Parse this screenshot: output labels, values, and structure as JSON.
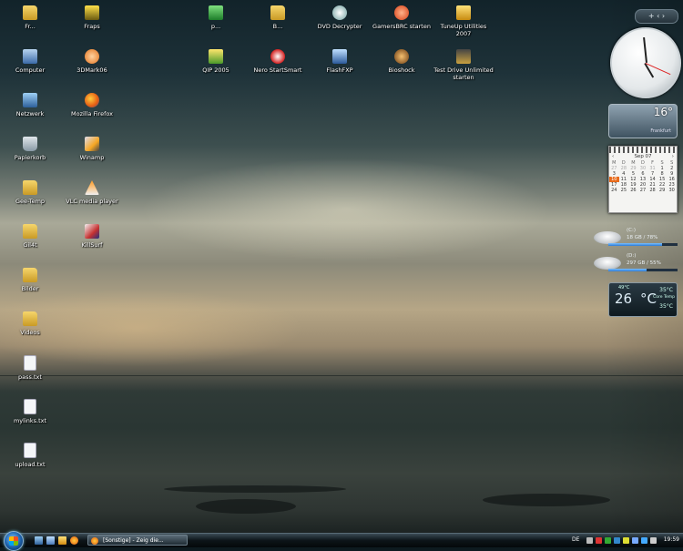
{
  "desktop": {
    "icons": [
      {
        "label": "Fr...",
        "glyph": "folder"
      },
      {
        "label": "Computer",
        "glyph": "computer"
      },
      {
        "label": "Netzwerk",
        "glyph": "network"
      },
      {
        "label": "Papierkorb",
        "glyph": "recycle-bin"
      },
      {
        "label": "Gee-Temp",
        "glyph": "folder"
      },
      {
        "label": "Gil4t",
        "glyph": "folder"
      },
      {
        "label": "Bilder",
        "glyph": "folder"
      },
      {
        "label": "Videos",
        "glyph": "folder"
      },
      {
        "label": "pass.txt",
        "glyph": "text-file"
      },
      {
        "label": "mylinks.txt",
        "glyph": "text-file"
      },
      {
        "label": "upload.txt",
        "glyph": "text-file"
      },
      {
        "label": "Fraps",
        "glyph": "fraps"
      },
      {
        "label": "3DMark06",
        "glyph": "3dmark"
      },
      {
        "label": "Mozilla Firefox",
        "glyph": "firefox"
      },
      {
        "label": "Winamp",
        "glyph": "winamp"
      },
      {
        "label": "VLC media player",
        "glyph": "vlc"
      },
      {
        "label": "KillSurf",
        "glyph": "killsurf"
      },
      {
        "label": "p...",
        "glyph": "green"
      },
      {
        "label": "QIP 2005",
        "glyph": "qip"
      },
      {
        "label": "B...",
        "glyph": "folder"
      },
      {
        "label": "Nero StartSmart",
        "glyph": "nero"
      },
      {
        "label": "DVD Decrypter",
        "glyph": "dvd"
      },
      {
        "label": "FlashFXP",
        "glyph": "flashfxp"
      },
      {
        "label": "GamersBRC starten",
        "glyph": "red"
      },
      {
        "label": "Bioshock",
        "glyph": "bioshock"
      },
      {
        "label": "TuneUp Utilities 2007",
        "glyph": "tuneup"
      },
      {
        "label": "Test Drive Unlimited starten",
        "glyph": "tdu"
      }
    ]
  },
  "sidebar": {
    "top_control": "+ ‹ ›",
    "clock": {
      "hour": 4,
      "minute": 59
    },
    "weather": {
      "temp": "16°",
      "place": "Frankfurt"
    },
    "calendar": {
      "month": "Sep 07",
      "weekdays": [
        "M",
        "D",
        "M",
        "D",
        "F",
        "S",
        "S"
      ],
      "weeks": [
        [
          "27",
          "28",
          "29",
          "30",
          "31",
          "1",
          "2"
        ],
        [
          "3",
          "4",
          "5",
          "6",
          "7",
          "8",
          "9"
        ],
        [
          "10",
          "11",
          "12",
          "13",
          "14",
          "15",
          "16"
        ],
        [
          "17",
          "18",
          "19",
          "20",
          "21",
          "22",
          "23"
        ],
        [
          "24",
          "25",
          "26",
          "27",
          "28",
          "29",
          "30"
        ]
      ],
      "today": "10"
    },
    "drives": [
      {
        "name": "(C:)",
        "info": "18 GB / 78%",
        "used_fraction": 0.78
      },
      {
        "name": "(D:)",
        "info": "297 GB / 55%",
        "used_fraction": 0.55
      }
    ],
    "cpu_temp": {
      "top": "49°C",
      "current": "26",
      "unit": "°C",
      "high": "35°C",
      "label": "Core Temp",
      "low": "35°C"
    }
  },
  "taskbar": {
    "task_label": "[Sonstige] - Zeig die...",
    "tray_lang": "DE",
    "tray_time": "19:59"
  },
  "colors": {
    "accent": "#1c5fa8",
    "taskbar": "#0c1418",
    "today": "#e86a1a"
  }
}
